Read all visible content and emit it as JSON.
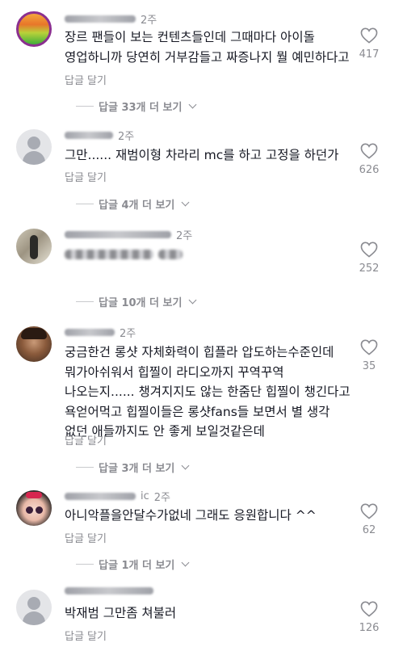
{
  "comments": [
    {
      "username": "hey_ilsoul_er",
      "time": "2주",
      "text": "장르 팬들이 보는 컨텐츠들인데 그때마다 아이돌\n영업하니까 당연히 거부감들고 짜증나지 뭘 예민하다고",
      "reply_label": "답글 달기",
      "likes": "417",
      "more_replies": "답글 33개 더 보기",
      "avatar": "sunset-avatar"
    },
    {
      "username": "holyjoluu",
      "time": "2주",
      "text": "그만...... 재범이형 차라리 mc를 하고 고정을 하던가",
      "reply_label": "답글 달기",
      "likes": "626",
      "more_replies": "답글 4개 더 보기",
      "avatar": "default-avatar"
    },
    {
      "username": "",
      "time": "2주",
      "text_suffix": "...돌",
      "reply_label": "",
      "likes": "252",
      "more_replies": "답글 10개 더 보기",
      "avatar": "photo-avatar"
    },
    {
      "username": "",
      "time": "2주",
      "text": "궁금한건 롱샷 자체화력이 힙플라 압도하는수준인데\n뭐가아쉬워서 힙찔이 라디오까지 꾸역꾸역\n나오는지...... 챙겨지지도 않는 한줌단 힙찔이 챙긴다고\n욕얻어먹고 힙찔이들은 롱샷fans들 보면서 별 생각\n없던 애들까지도 안 좋게 보일것같은데",
      "reply_label": "답글 달기",
      "likes": "35",
      "more_replies": "답글 3개 더 보기",
      "avatar": "photo-avatar"
    },
    {
      "username": "ic",
      "time": "2주",
      "text": "아니악플을안달수가없네 그래도 응원합니다 ^^",
      "reply_label": "답글 달기",
      "likes": "62",
      "more_replies": "답글 1개 더 보기",
      "avatar": "cartoon-avatar"
    },
    {
      "username": "",
      "time": "",
      "text": "박재범 그만좀 쳐불러",
      "reply_label": "답글 달기",
      "likes": "126",
      "avatar": "default-avatar"
    }
  ],
  "icons": {
    "like": "heart-outline-icon",
    "expand": "chevron-down-icon"
  }
}
